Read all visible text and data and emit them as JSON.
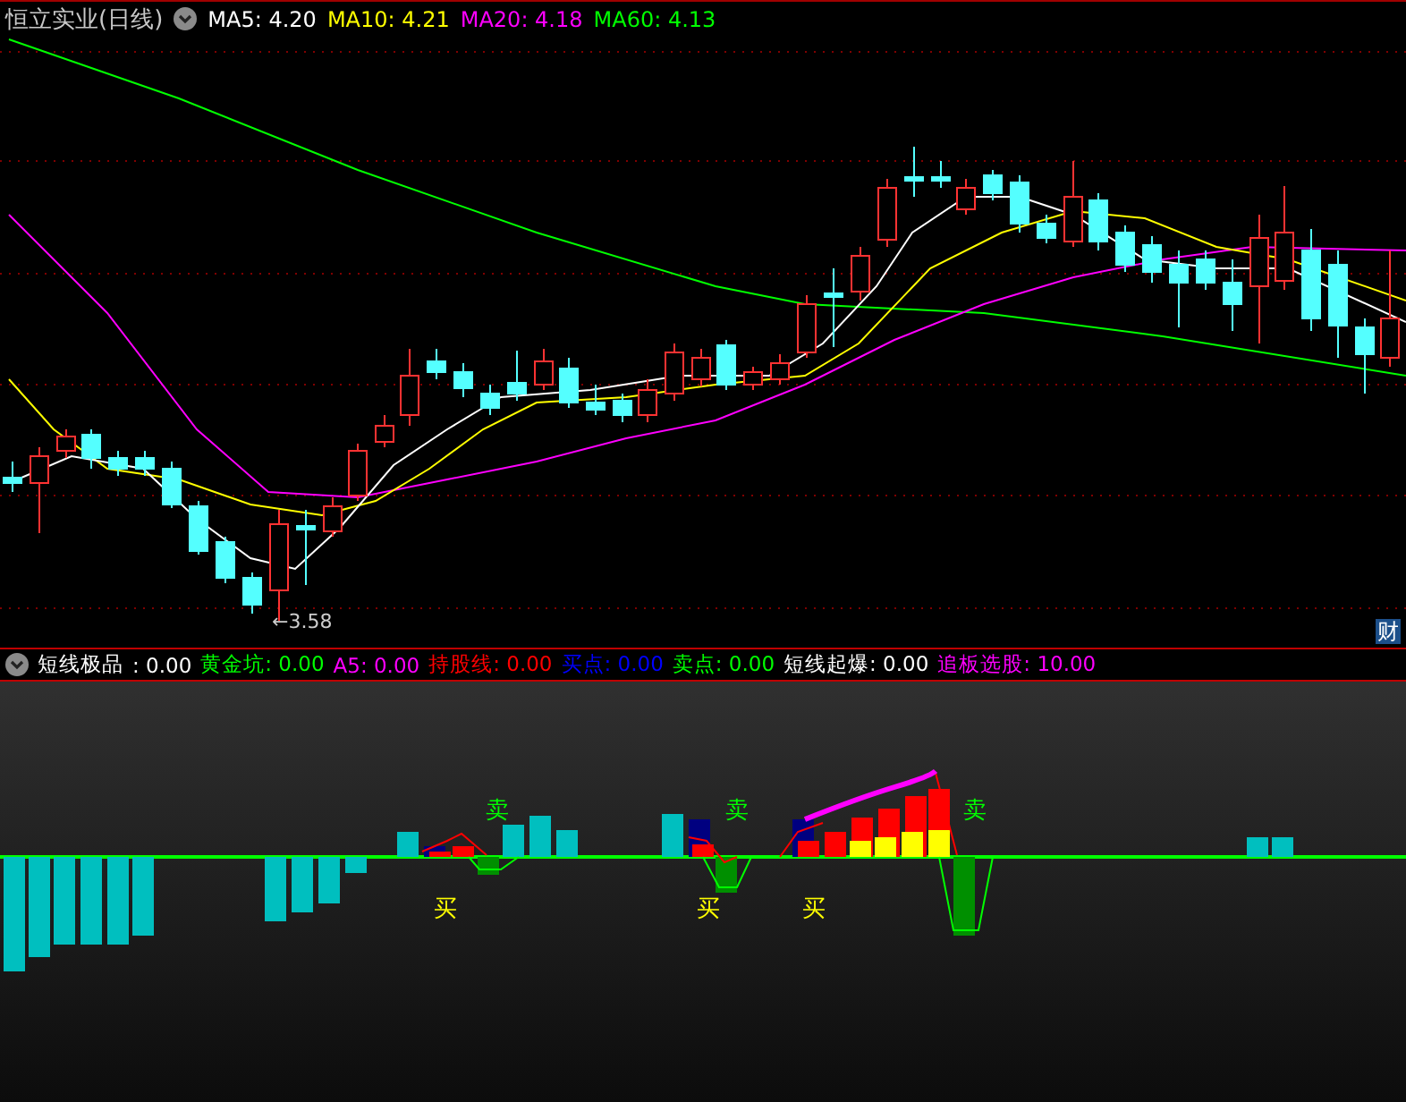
{
  "title": "恒立实业(日线)",
  "ma_legend": [
    {
      "label": "MA5: 4.20",
      "color": "#ffffff"
    },
    {
      "label": "MA10: 4.21",
      "color": "#ffff00"
    },
    {
      "label": "MA20: 4.18",
      "color": "#ff00ff"
    },
    {
      "label": "MA60: 4.13",
      "color": "#00ff00"
    }
  ],
  "low_marker": "←3.58",
  "corner_badge": "财",
  "indicator": {
    "name": "短线极品",
    "values": [
      {
        "label": ": 0.00",
        "color": "#ffffff"
      },
      {
        "label": "黄金坑: 0.00",
        "color": "#00ff00"
      },
      {
        "label": "A5: 0.00",
        "color": "#ff00ff"
      },
      {
        "label": "持股线: 0.00",
        "color": "#ff0000"
      },
      {
        "label": "买点: 0.00",
        "color": "#0000ff"
      },
      {
        "label": "卖点: 0.00",
        "color": "#00ff00"
      },
      {
        "label": "短线起爆: 0.00",
        "color": "#ffffff"
      },
      {
        "label": "追板选股: 10.00",
        "color": "#ff00ff"
      }
    ]
  },
  "signals": [
    {
      "text": "卖",
      "kind": "sell"
    },
    {
      "text": "买",
      "kind": "buy"
    },
    {
      "text": "卖",
      "kind": "sell"
    },
    {
      "text": "买",
      "kind": "buy"
    },
    {
      "text": "买",
      "kind": "buy"
    },
    {
      "text": "卖",
      "kind": "sell"
    }
  ]
}
